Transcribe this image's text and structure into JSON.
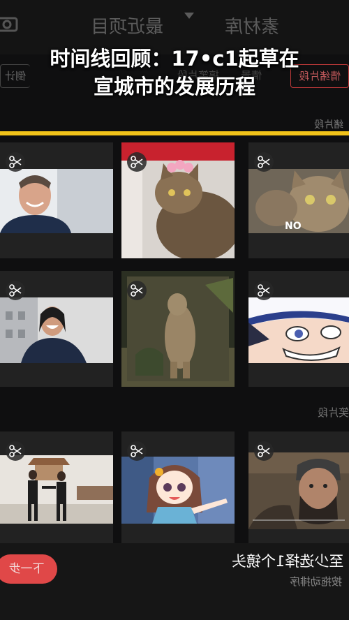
{
  "overlay": {
    "headline_line1": "时间线回顾：17•c1起草在",
    "headline_line2": "宣城市的发展历程"
  },
  "topbar": {
    "recent_label": "最近项目",
    "library_label": "素材库",
    "camera_icon": "camera-icon",
    "dropdown_icon": "caret-down-icon"
  },
  "chips": {
    "left": "倒计",
    "mid1": "搞笑片段",
    "mid2": "情景",
    "right": "情绪片段"
  },
  "sections": {
    "label1": "绪片段",
    "label2": "笑片段"
  },
  "tiles": [
    {
      "name": "smiling-man-tile"
    },
    {
      "name": "cat-with-flower-tile"
    },
    {
      "name": "cat-closeup-tile"
    },
    {
      "name": "laughing-man-tile"
    },
    {
      "name": "standing-marmot-tile"
    },
    {
      "name": "anime-grin-tile"
    },
    {
      "name": "dancing-pallbearers-tile"
    },
    {
      "name": "anime-girl-pointing-tile"
    },
    {
      "name": "bearded-warrior-tile"
    }
  ],
  "footer": {
    "next_label": "下一步",
    "hint_main": "至少选择1个镜头",
    "hint_sub": "按拖动排序"
  },
  "colors": {
    "accent_yellow": "#f2c31a",
    "accent_red": "#e04848"
  }
}
